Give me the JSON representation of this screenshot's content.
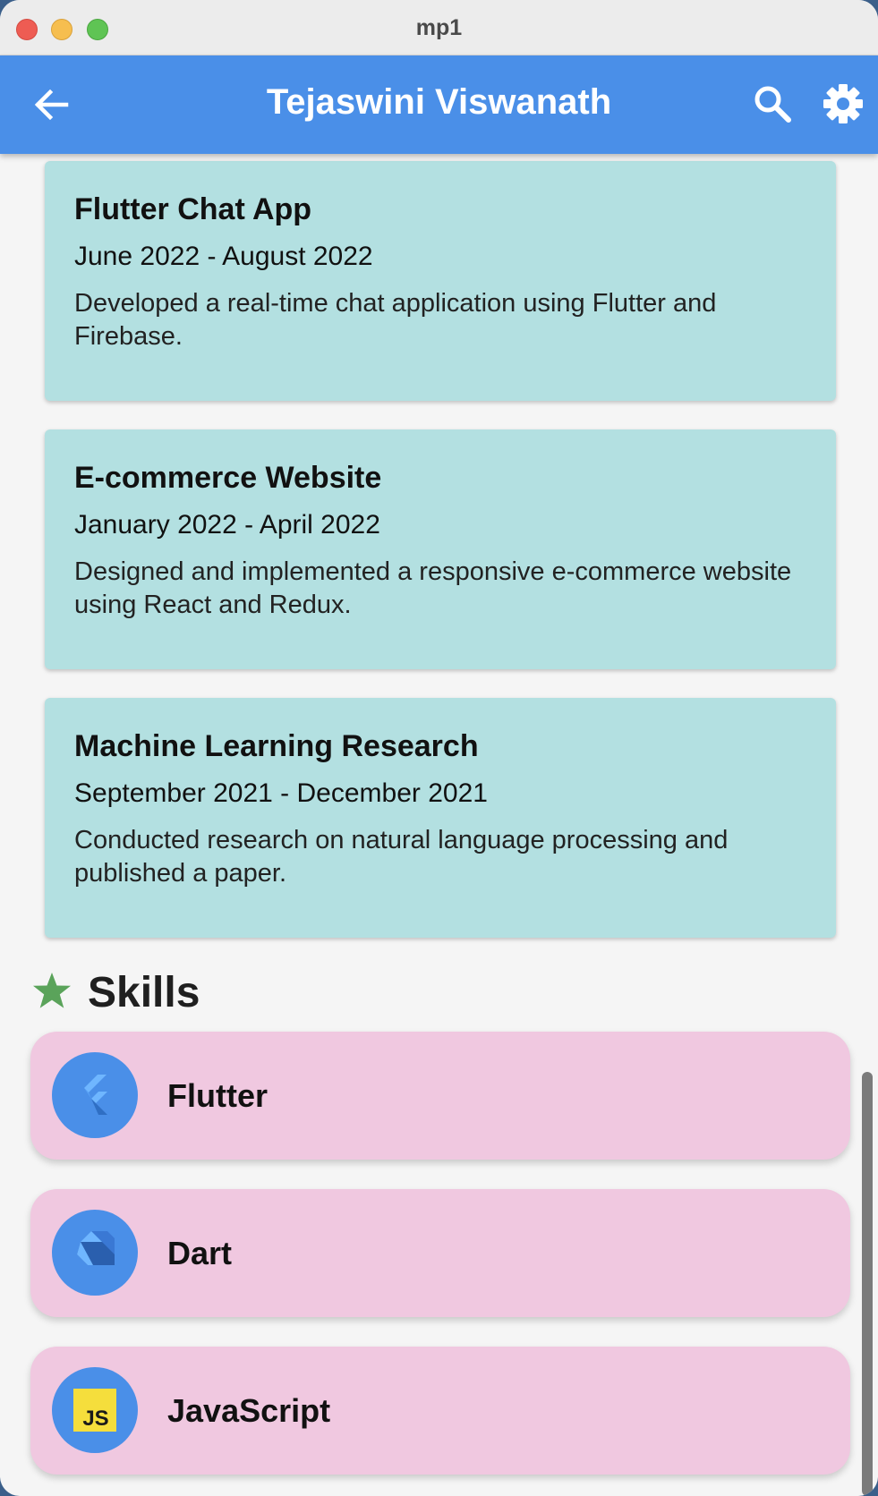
{
  "window": {
    "title": "mp1"
  },
  "appbar": {
    "title": "Tejaswini Viswanath",
    "back_icon": "arrow-left-icon",
    "search_icon": "search-icon",
    "settings_icon": "gear-icon"
  },
  "experience": [
    {
      "title": "Flutter Chat App",
      "date": "June 2022 - August 2022",
      "description": "Developed a real-time chat application using Flutter and Firebase."
    },
    {
      "title": "E-commerce Website",
      "date": "January 2022 - April 2022",
      "description": "Designed and implemented a responsive e-commerce website using React and Redux."
    },
    {
      "title": "Machine Learning Research",
      "date": "September 2021 - December 2021",
      "description": "Conducted research on natural language processing and published a paper."
    }
  ],
  "skills": {
    "heading": "Skills",
    "heading_icon": "star-icon",
    "items": [
      {
        "name": "Flutter",
        "icon": "flutter-logo-icon"
      },
      {
        "name": "Dart",
        "icon": "dart-logo-icon"
      },
      {
        "name": "JavaScript",
        "icon": "javascript-logo-icon",
        "icon_text": "JS"
      }
    ]
  },
  "colors": {
    "appbar": "#4a8fe8",
    "experience_card": "#b3e0e1",
    "skill_card": "#f0c8e0",
    "star": "#5aa35a",
    "js_badge": "#f5de3c"
  }
}
